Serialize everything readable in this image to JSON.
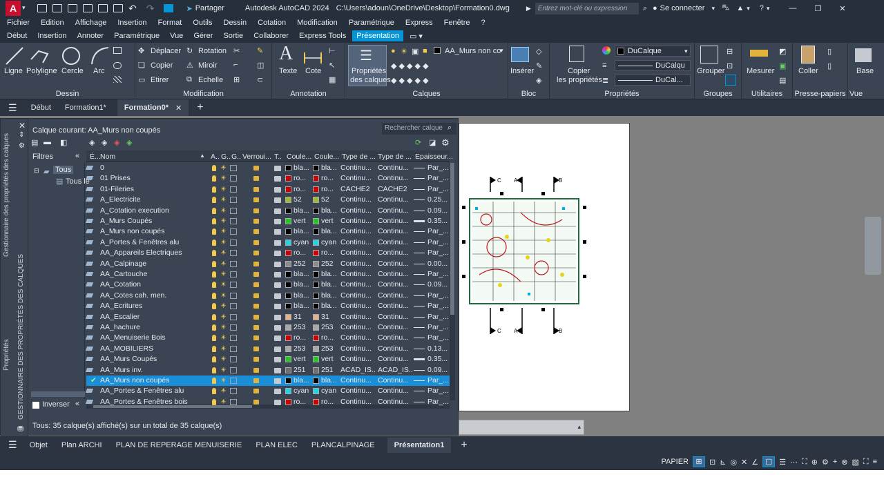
{
  "titlebar": {
    "logo": "A",
    "share": "Partager",
    "title": "Autodesk AutoCAD 2024",
    "path": "C:\\Users\\adoun\\OneDrive\\Desktop\\Formation0.dwg",
    "search_placeholder": "Entrez mot-clé ou expression",
    "signin": "Se connecter"
  },
  "menubar": [
    "Fichier",
    "Edition",
    "Affichage",
    "Insertion",
    "Format",
    "Outils",
    "Dessin",
    "Cotation",
    "Modification",
    "Paramétrique",
    "Express",
    "Fenêtre",
    "?"
  ],
  "ribbon_tabs": {
    "items": [
      "Début",
      "Insertion",
      "Annoter",
      "Paramétrique",
      "Vue",
      "Gérer",
      "Sortie",
      "Collaborer",
      "Express Tools",
      "Présentation"
    ],
    "active": "Présentation"
  },
  "ribbon": {
    "dessin": {
      "label": "Dessin",
      "ligne": "Ligne",
      "polyligne": "Polyligne",
      "cercle": "Cercle",
      "arc": "Arc"
    },
    "modification": {
      "label": "Modification",
      "deplacer": "Déplacer",
      "rotation": "Rotation",
      "copier": "Copier",
      "miroir": "Miroir",
      "etirer": "Etirer",
      "echelle": "Echelle"
    },
    "annotation": {
      "label": "Annotation",
      "texte": "Texte",
      "cote": "Cote"
    },
    "calques": {
      "label": "Calques",
      "props_line1": "Propriétés",
      "props_line2": "des calques",
      "current_layer": "AA_Murs non co"
    },
    "bloc": {
      "label": "Bloc",
      "inserer": "Insérer"
    },
    "proprietes": {
      "label": "Propriétés",
      "copier1": "Copier",
      "copier2": "les propriétés",
      "color": "DuCalque",
      "linetype": "DuCalqu",
      "lineweight": "DuCal..."
    },
    "groupes": {
      "label": "Groupes",
      "grouper": "Grouper"
    },
    "utilitaires": {
      "label": "Utilitaires",
      "mesurer": "Mesurer"
    },
    "presse": {
      "label": "Presse-papiers",
      "coller": "Coller"
    },
    "vue": {
      "label": "Vue",
      "base": "Base"
    }
  },
  "filetabs": [
    "Début",
    "Formation1*",
    "Formation0*"
  ],
  "palette": {
    "current_layer": "Calque courant: AA_Murs non coupés",
    "search_placeholder": "Rechercher calque",
    "filters_label": "Filtres",
    "tree_all": "Tous",
    "tree_used": "Tous le",
    "invert": "Inverser",
    "side_title": "Gestionnaire des propriétés des calques",
    "side_title2": "GESTIONNAIRE DES PROPRIÉTÉS DES CALQUES",
    "side_props": "Propriétés",
    "columns": [
      "É...",
      "Nom",
      "A..",
      "G..",
      "G..",
      "Verroui...",
      "T..",
      "Coule...",
      "Coule...",
      "Type de ...",
      "Type de ...",
      "Epaisseur..."
    ],
    "status": "Tous: 35 calque(s) affiché(s) sur un total de 35 calque(s)",
    "layers": [
      {
        "name": "0",
        "color": "#000000",
        "cname": "bla...",
        "lt": "Continu...",
        "lt2": "Continu...",
        "lw": "Par_...",
        "thick": false,
        "sel": false
      },
      {
        "name": "01 Prises",
        "color": "#cc0000",
        "cname": "ro...",
        "lt": "Continu...",
        "lt2": "Continu...",
        "lw": "Par_...",
        "thick": false,
        "sel": false
      },
      {
        "name": "01-Fileries",
        "color": "#cc0000",
        "cname": "ro...",
        "lt": "CACHE2",
        "lt2": "CACHE2",
        "lw": "Par_...",
        "thick": false,
        "sel": false
      },
      {
        "name": "A_Electricite",
        "color": "#a2b835",
        "cname": "52",
        "lt": "Continu...",
        "lt2": "Continu...",
        "lw": "0.25...",
        "thick": false,
        "sel": false
      },
      {
        "name": "A_Cotation execution",
        "color": "#000000",
        "cname": "bla...",
        "lt": "Continu...",
        "lt2": "Continu...",
        "lw": "0.09...",
        "thick": false,
        "sel": false
      },
      {
        "name": "A_Murs  Coupés",
        "color": "#22c722",
        "cname": "vert",
        "lt": "Continu...",
        "lt2": "Continu...",
        "lw": "0.35...",
        "thick": true,
        "sel": false
      },
      {
        "name": "A_Murs non coupés",
        "color": "#000000",
        "cname": "bla...",
        "lt": "Continu...",
        "lt2": "Continu...",
        "lw": "Par_...",
        "thick": false,
        "sel": false
      },
      {
        "name": "A_Portes & Fenêtres alu",
        "color": "#22d3e6",
        "cname": "cyan",
        "lt": "Continu...",
        "lt2": "Continu...",
        "lw": "Par_...",
        "thick": false,
        "sel": false
      },
      {
        "name": "AA_Appareils Electriques",
        "color": "#cc0000",
        "cname": "ro...",
        "lt": "Continu...",
        "lt2": "Continu...",
        "lw": "Par_...",
        "thick": false,
        "sel": false
      },
      {
        "name": "AA_Calpinage",
        "color": "#8a8a8a",
        "cname": "252",
        "lt": "Continu...",
        "lt2": "Continu...",
        "lw": "0.00...",
        "thick": false,
        "sel": false
      },
      {
        "name": "AA_Cartouche",
        "color": "#000000",
        "cname": "bla...",
        "lt": "Continu...",
        "lt2": "Continu...",
        "lw": "Par_...",
        "thick": false,
        "sel": false
      },
      {
        "name": "AA_Cotation",
        "color": "#000000",
        "cname": "bla...",
        "lt": "Continu...",
        "lt2": "Continu...",
        "lw": "0.09...",
        "thick": false,
        "sel": false
      },
      {
        "name": "AA_Cotes cah. men.",
        "color": "#000000",
        "cname": "bla...",
        "lt": "Continu...",
        "lt2": "Continu...",
        "lw": "Par_...",
        "thick": false,
        "sel": false
      },
      {
        "name": "AA_Ecritures",
        "color": "#000000",
        "cname": "bla...",
        "lt": "Continu...",
        "lt2": "Continu...",
        "lw": "Par_...",
        "thick": false,
        "sel": false
      },
      {
        "name": "AA_Escalier",
        "color": "#e3b18a",
        "cname": "31",
        "lt": "Continu...",
        "lt2": "Continu...",
        "lw": "Par_...",
        "thick": false,
        "sel": false
      },
      {
        "name": "AA_hachure",
        "color": "#a8a8a8",
        "cname": "253",
        "lt": "Continu...",
        "lt2": "Continu...",
        "lw": "Par_...",
        "thick": false,
        "sel": false
      },
      {
        "name": "AA_Menuiserie Bois",
        "color": "#cc0000",
        "cname": "ro...",
        "lt": "Continu...",
        "lt2": "Continu...",
        "lw": "Par_...",
        "thick": false,
        "sel": false
      },
      {
        "name": "AA_MOBILIERS",
        "color": "#a8a8a8",
        "cname": "253",
        "lt": "Continu...",
        "lt2": "Continu...",
        "lw": "0.13...",
        "thick": false,
        "sel": false
      },
      {
        "name": "AA_Murs  Coupés",
        "color": "#22c722",
        "cname": "vert",
        "lt": "Continu...",
        "lt2": "Continu...",
        "lw": "0.35...",
        "thick": true,
        "sel": false
      },
      {
        "name": "AA_Murs inv.",
        "color": "#6e6e6e",
        "cname": "251",
        "lt": "ACAD_IS...",
        "lt2": "ACAD_IS...",
        "lw": "0.09...",
        "thick": false,
        "sel": false
      },
      {
        "name": "AA_Murs non coupés",
        "color": "#000000",
        "cname": "bla...",
        "lt": "Continu...",
        "lt2": "Continu...",
        "lw": "Par_...",
        "thick": false,
        "sel": true
      },
      {
        "name": "AA_Portes & Fenêtres alu",
        "color": "#22d3e6",
        "cname": "cyan",
        "lt": "Continu...",
        "lt2": "Continu...",
        "lw": "Par_...",
        "thick": false,
        "sel": false
      },
      {
        "name": "AA_Portes & Fenêtres bois",
        "color": "#cc0000",
        "cname": "ro...",
        "lt": "Continu...",
        "lt2": "Continu...",
        "lw": "Par_...",
        "thick": false,
        "sel": false
      }
    ]
  },
  "layouttabs": [
    "Objet",
    "Plan ARCHI",
    "PLAN DE REPERAGE MENUISERIE",
    "PLAN ELEC",
    "PLANCALPINAGE",
    "Présentation1"
  ],
  "statusbar": {
    "mode": "PAPIER"
  },
  "drawing_labels": {
    "c": "C",
    "a": "A",
    "b": "B"
  }
}
